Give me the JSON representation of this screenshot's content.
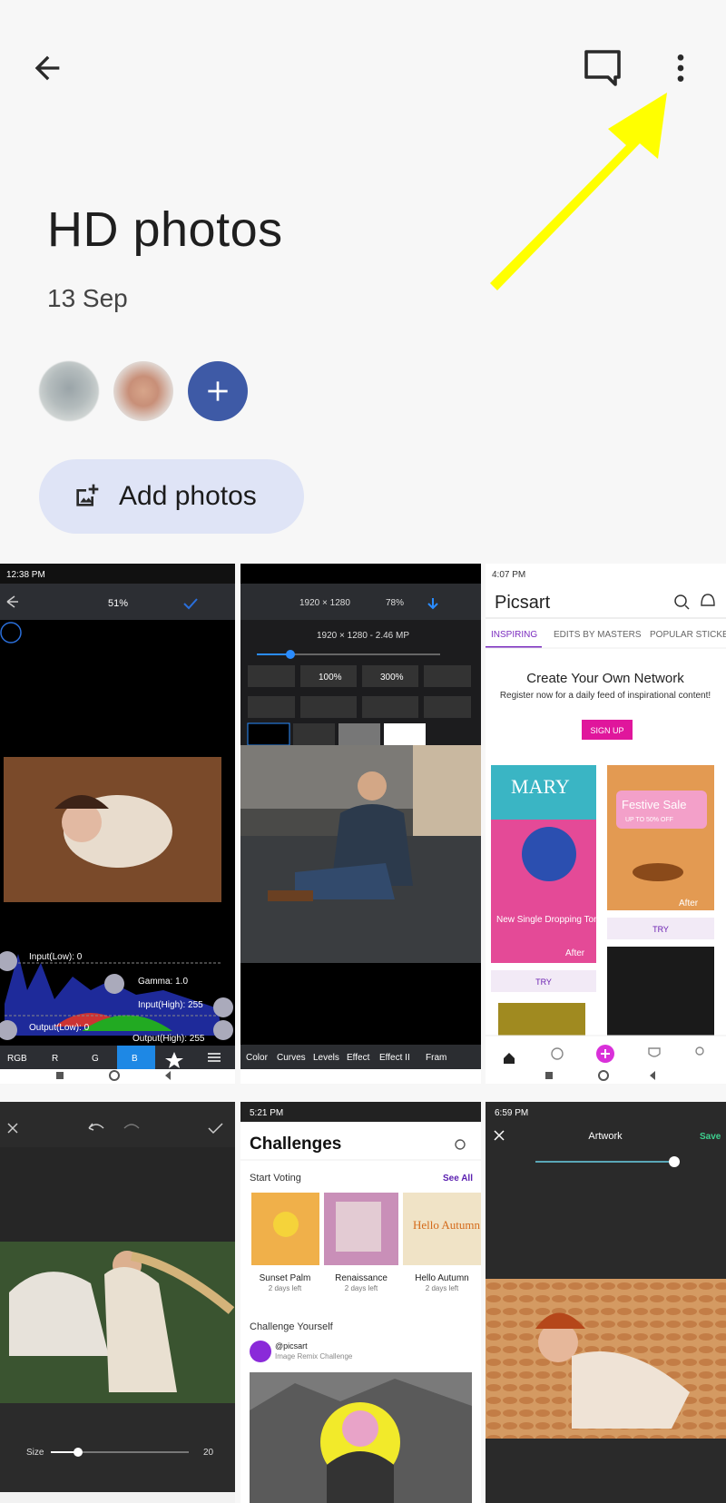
{
  "album": {
    "title": "HD photos",
    "date": "13 Sep"
  },
  "actions": {
    "add_photos": "Add photos"
  },
  "icons": {
    "back": "back-arrow-icon",
    "comment": "comment-icon",
    "more": "more-vert-icon",
    "add_person": "plus-icon",
    "add_photo": "add-photo-icon"
  },
  "colors": {
    "accent": "#3e5aa6",
    "chip": "#dfe4f6",
    "annotation": "#ffff00"
  },
  "thumbs": {
    "t1": {
      "time": "12:38 PM",
      "zoom": "51%",
      "labels": {
        "input_low": "Input(Low): 0",
        "gamma": "Gamma: 1.0",
        "input_high": "Input(High): 255",
        "output_low": "Output(Low): 0",
        "output_high": "Output(High): 255"
      },
      "channels": [
        "RGB",
        "R",
        "G",
        "B"
      ]
    },
    "t2": {
      "size": "1920 × 1280",
      "zoom": "78%",
      "meta": "1920 × 1280 - 2.46 MP",
      "scale": [
        "100%",
        "300%"
      ],
      "tabs": [
        "Color",
        "Curves",
        "Levels",
        "Effect",
        "Effect II",
        "Fram"
      ]
    },
    "t3": {
      "time": "4:07 PM",
      "brand": "Picsart",
      "tabs": [
        "INSPIRING",
        "EDITS BY MASTERS",
        "POPULAR STICKE"
      ],
      "headline": "Create Your Own Network",
      "sub": "Register now for a daily feed of inspirational content!",
      "signup": "SIGN UP",
      "card1": {
        "title": "MARY",
        "text": "New Single Dropping Tonight",
        "after": "After"
      },
      "card2": {
        "title": "Festive Sale",
        "sub": "UP TO 50% OFF",
        "after": "After"
      },
      "try": "TRY"
    },
    "t4": {
      "size_label": "Size",
      "size_value": "20"
    },
    "t5": {
      "time": "5:21 PM",
      "title": "Challenges",
      "start_voting": "Start Voting",
      "see_all": "See All",
      "items": [
        {
          "name": "Sunset Palm",
          "left": "2 days left"
        },
        {
          "name": "Renaissance",
          "left": "2 days left"
        },
        {
          "name": "Hello Autumn",
          "left": "2 days left"
        }
      ],
      "yourself": "Challenge Yourself",
      "handle": "@picsart",
      "challenge": "Image Remix Challenge"
    },
    "t6": {
      "time": "6:59 PM",
      "title": "Artwork",
      "save": "Save"
    }
  }
}
